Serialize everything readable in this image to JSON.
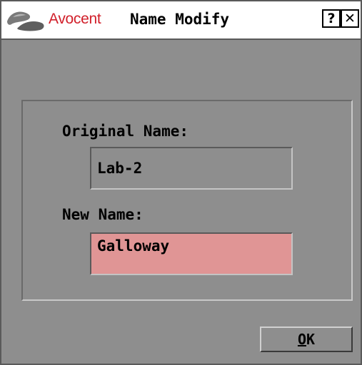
{
  "titlebar": {
    "logo_icon": "avocent-logo-icon",
    "brand": "Avocent",
    "title": "Name Modify",
    "help_label": "?",
    "close_label": "✕",
    "brand_color": "#d11f2a"
  },
  "form": {
    "original_name_label": "Original Name:",
    "original_name_value": "Lab-2",
    "new_name_label": "New Name:",
    "new_name_value": "Galloway",
    "new_name_field_color": "#e09595"
  },
  "buttons": {
    "ok_mnemonic": "O",
    "ok_rest": "K"
  },
  "colors": {
    "window_background": "#8e8e8e",
    "titlebar_background": "#ffffff"
  }
}
